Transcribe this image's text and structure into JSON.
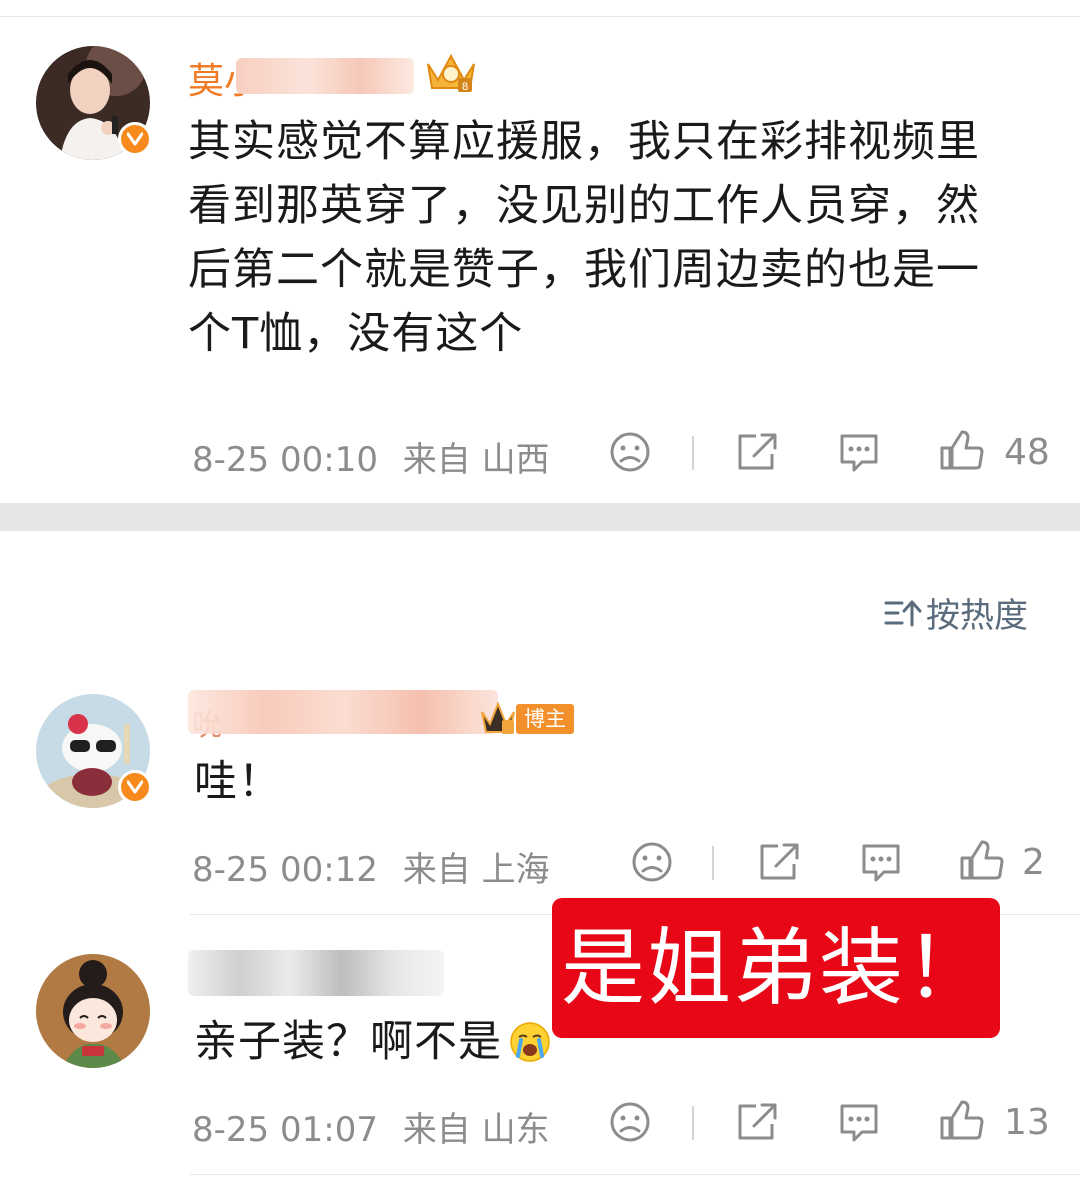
{
  "comments": [
    {
      "username": "莫小",
      "text": "其实感觉不算应援服，我只在彩排视频里看到那英穿了，没见别的工作人员穿，然后第二个就是赞子，我们周边卖的也是一个T恤，没有这个",
      "lines": [
        "其实感觉不算应援服，我只在彩排视频里",
        "看到那英穿了，没见别的工作人员穿，然",
        "后第二个就是赞子，我们周边卖的也是一",
        "个T恤，没有这个"
      ],
      "date": "8-25 00:10",
      "location": "来自 山西",
      "likes": "48"
    }
  ],
  "sort": {
    "label": "按热度"
  },
  "replies": [
    {
      "username": "吮",
      "tag": "博主",
      "text": "哇！",
      "date": "8-25 00:12",
      "location": "来自 上海",
      "likes": "2"
    },
    {
      "username": "",
      "text": "亲子装？啊不是",
      "date": "8-25 01:07",
      "location": "来自 山东",
      "likes": "13"
    }
  ],
  "overlay": {
    "label": "是姐弟装！"
  },
  "colors": {
    "username": "#f07b25",
    "meta": "#8c8c8c",
    "overlay_bg": "#e70716",
    "blogger_tag": "#f3902b",
    "verified_badge": "#f78a1c"
  },
  "icons": [
    "verified-icon",
    "crown-badge-icon",
    "dislike-face-icon",
    "share-icon",
    "comment-icon",
    "like-icon",
    "sort-icon",
    "crying-emoji"
  ]
}
